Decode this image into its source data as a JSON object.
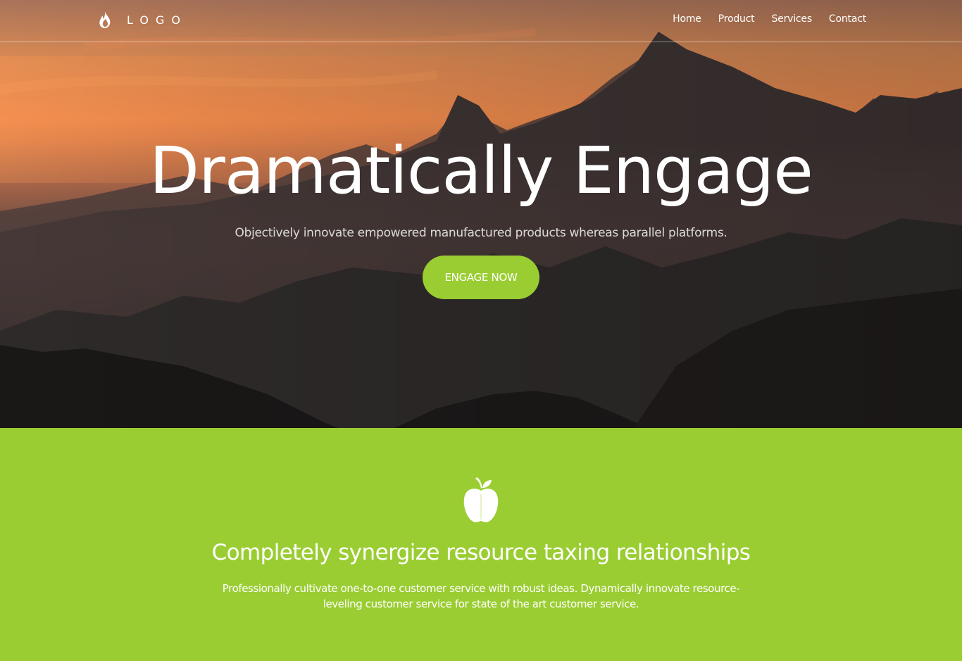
{
  "brand": {
    "logo_icon": "flame-icon",
    "logo_text": "LOGO"
  },
  "nav": {
    "items": [
      {
        "label": "Home"
      },
      {
        "label": "Product"
      },
      {
        "label": "Services"
      },
      {
        "label": "Contact"
      }
    ]
  },
  "hero": {
    "title": "Dramatically Engage",
    "subtitle": "Objectively innovate empowered manufactured products whereas parallel platforms.",
    "cta_label": "ENGAGE NOW",
    "background": "mountain-sunset-image"
  },
  "feature": {
    "icon": "apple-icon",
    "title": "Completely synergize resource taxing relationships",
    "text": "Professionally cultivate one-to-one customer service with robust ideas. Dynamically innovate resource-leveling customer service for state of the art customer service."
  },
  "colors": {
    "accent": "#9acd32",
    "text_light": "#ffffff"
  }
}
